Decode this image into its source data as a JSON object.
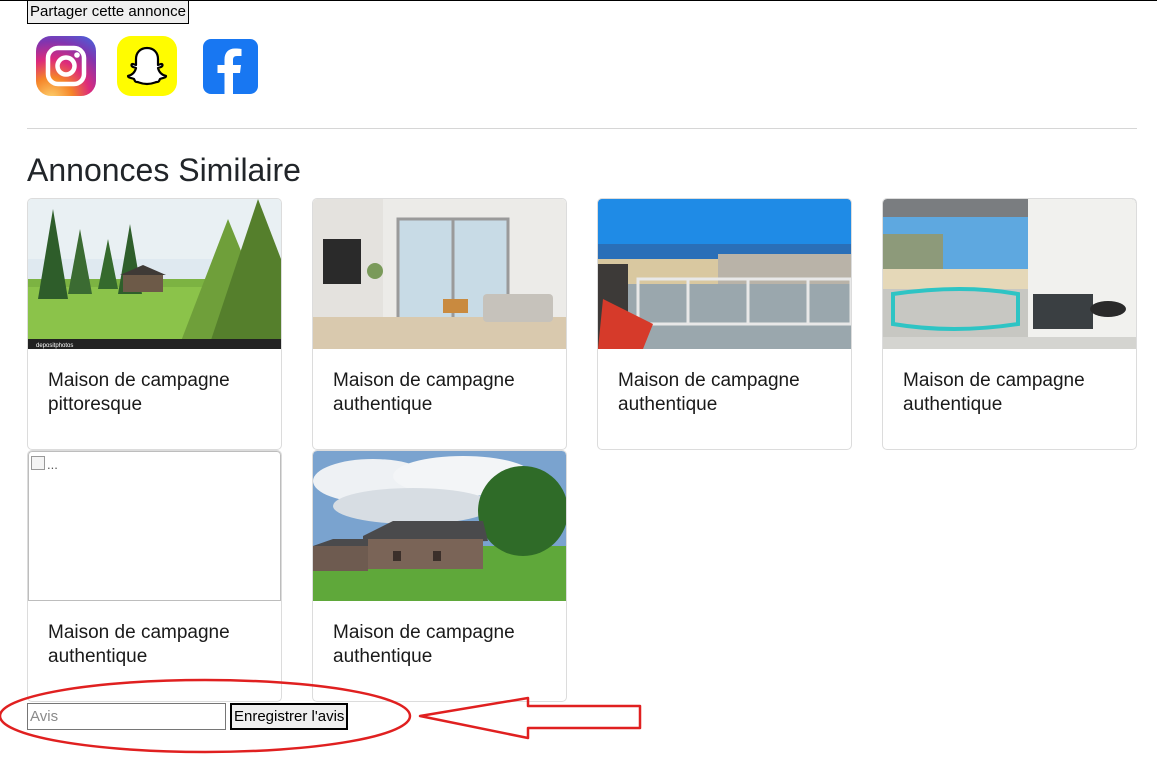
{
  "share": {
    "label": "Partager cette annonce"
  },
  "social": [
    {
      "name": "instagram-icon",
      "color": "#e1306c"
    },
    {
      "name": "snapchat-icon",
      "color": "#fffc00"
    },
    {
      "name": "facebook-icon",
      "color": "#1877f2"
    }
  ],
  "section": {
    "title": "Annonces Similaire"
  },
  "listings": [
    {
      "title": "Maison de campagne pittoresque",
      "image": "forest-cabin",
      "watermark": "depositphotos"
    },
    {
      "title": "Maison de campagne authentique",
      "image": "living-room"
    },
    {
      "title": "Maison de campagne authentique",
      "image": "balcony-beach"
    },
    {
      "title": "Maison de campagne authentique",
      "image": "terrace-sea"
    },
    {
      "title": "Maison de campagne authentique",
      "image": "broken",
      "alt": "..."
    },
    {
      "title": "Maison de campagne authentique",
      "image": "stone-farmhouse"
    }
  ],
  "review": {
    "placeholder": "Avis",
    "value": "",
    "submit_label": "Enregistrer l'avis"
  },
  "annotation": {
    "color": "#e02020"
  }
}
